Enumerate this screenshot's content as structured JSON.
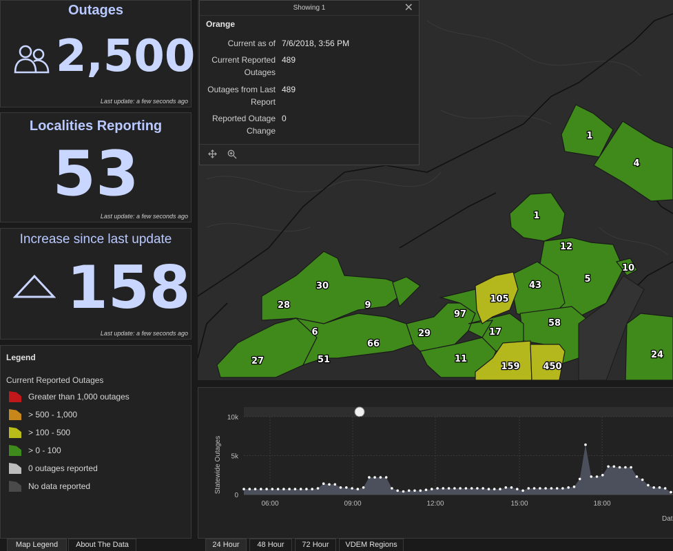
{
  "outages": {
    "title": "Outages",
    "value": "2,500",
    "updated": "Last update: a few seconds ago",
    "icon": "people-icon"
  },
  "localities": {
    "title": "Localities Reporting",
    "value": "53",
    "updated": "Last update: a few seconds ago"
  },
  "increase": {
    "title": "Increase since last update",
    "value": "158",
    "updated": "Last update: a few seconds ago",
    "icon": "triangle-up-icon"
  },
  "legend": {
    "title": "Legend",
    "subtitle": "Current Reported Outages",
    "items": [
      {
        "label": "Greater than 1,000 outages",
        "color": "#c0181b"
      },
      {
        "label": "> 500 - 1,000",
        "color": "#c8871a"
      },
      {
        "label": "> 100 - 500",
        "color": "#b9bd1a"
      },
      {
        "label": "> 0 - 100",
        "color": "#3e8a1a"
      },
      {
        "label": "0 outages reported",
        "color": "#bdbdbd"
      },
      {
        "label": "No data reported",
        "color": "#4a4a4a"
      }
    ]
  },
  "left_tabs": [
    "Map Legend",
    "About The Data"
  ],
  "bottom_tabs": [
    "24 Hour",
    "48 Hour",
    "72 Hour",
    "VDEM Regions"
  ],
  "popup": {
    "header": "Showing 1",
    "name": "Orange",
    "rows": [
      {
        "key": "Current as of",
        "value": "7/6/2018, 3:56 PM"
      },
      {
        "key": "Current Reported Outages",
        "value": "489"
      },
      {
        "key": "Outages from Last Report",
        "value": "489"
      },
      {
        "key": "Reported Outage Change",
        "value": "0"
      }
    ],
    "tools": [
      "pan-icon",
      "zoom-to-icon"
    ]
  },
  "map": {
    "labels": [
      "1",
      "4",
      "1",
      "12",
      "10",
      "43",
      "5",
      "105",
      "30",
      "28",
      "9",
      "97",
      "58",
      "6",
      "66",
      "29",
      "17",
      "27",
      "51",
      "11",
      "159",
      "450",
      "24"
    ],
    "colors": {
      "low": "#3f8a1a",
      "mid": "#b5b81c",
      "base": "#2c2c2c"
    }
  },
  "chart_data": {
    "type": "area",
    "ylabel": "Statewide Outages",
    "ylim": [
      0,
      10000
    ],
    "yticks": [
      "0",
      "5k",
      "10k"
    ],
    "xticks": [
      "06:00",
      "09:00",
      "12:00",
      "15:00",
      "18:00"
    ],
    "partial_xlabel": "Dat",
    "series": [
      {
        "values": [
          700,
          700,
          700,
          700,
          700,
          700,
          700,
          700,
          700,
          700,
          700,
          700,
          700,
          800,
          1400,
          1300,
          1300,
          900,
          900,
          800,
          700,
          900,
          2200,
          2200,
          2200,
          2200,
          800,
          500,
          400,
          500,
          500,
          500,
          600,
          700,
          800,
          800,
          800,
          800,
          800,
          800,
          800,
          800,
          800,
          700,
          700,
          700,
          900,
          900,
          700,
          500,
          800,
          800,
          800,
          800,
          800,
          800,
          800,
          900,
          1000,
          2000,
          6400,
          2300,
          2300,
          2500,
          3600,
          3600,
          3500,
          3500,
          3500,
          2300,
          1900,
          1200,
          900,
          900,
          800,
          300
        ]
      }
    ]
  }
}
